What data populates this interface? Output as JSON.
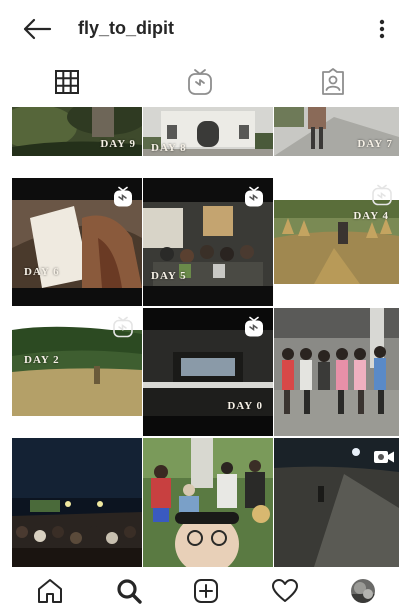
{
  "header": {
    "username": "fly_to_dipit"
  },
  "tabs": [
    {
      "icon": "grid-icon",
      "active": true
    },
    {
      "icon": "igtv-icon",
      "active": false
    },
    {
      "icon": "tagged-icon",
      "active": false
    }
  ],
  "posts": [
    {
      "label": "DAY 9",
      "media": "photo"
    },
    {
      "label": "DAY 8",
      "media": "photo"
    },
    {
      "label": "DAY 7",
      "media": "photo"
    },
    {
      "label": "DAY 6",
      "media": "igtv"
    },
    {
      "label": "DAY 5",
      "media": "igtv"
    },
    {
      "label": "DAY 4",
      "media": "igtv"
    },
    {
      "label": "DAY 2",
      "media": "igtv"
    },
    {
      "label": "DAY 0",
      "media": "igtv"
    },
    {
      "label": "",
      "media": "photo"
    },
    {
      "label": "",
      "media": "photo"
    },
    {
      "label": "",
      "media": "photo"
    },
    {
      "label": "",
      "media": "video"
    }
  ],
  "bottom_nav": [
    {
      "icon": "home-icon",
      "active": false
    },
    {
      "icon": "search-icon",
      "active": true
    },
    {
      "icon": "add-post-icon",
      "active": false
    },
    {
      "icon": "heart-icon",
      "active": false
    },
    {
      "icon": "profile-avatar",
      "active": false
    }
  ],
  "colors": {
    "text": "#262626",
    "separator": "#dbdbdb"
  }
}
